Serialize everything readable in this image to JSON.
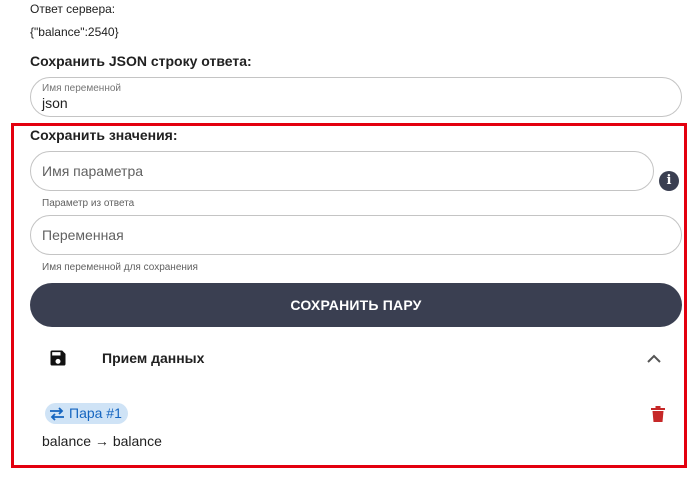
{
  "server": {
    "label": "Ответ сервера:",
    "value": "{\"balance\":2540}"
  },
  "json_section": {
    "title": "Сохранить JSON строку ответа:",
    "field_label": "Имя переменной",
    "field_value": "json"
  },
  "values_section": {
    "title": "Сохранить значения:",
    "param_placeholder": "Имя параметра",
    "param_hint": "Параметр из ответа",
    "var_placeholder": "Переменная",
    "var_hint": "Имя переменной для сохранения",
    "save_button": "СОХРАНИТЬ ПАРУ"
  },
  "panel": {
    "title": "Прием данных",
    "icon": "save-icon",
    "expanded": true
  },
  "pairs": [
    {
      "chip_label": "Пара #1",
      "mapping": "balance → balance"
    }
  ],
  "colors": {
    "highlight_border": "#e3000f",
    "button_bg": "#3a3f51",
    "chip_bg": "#cfe3f6",
    "chip_text": "#1565c0",
    "delete_icon": "#c62828"
  }
}
